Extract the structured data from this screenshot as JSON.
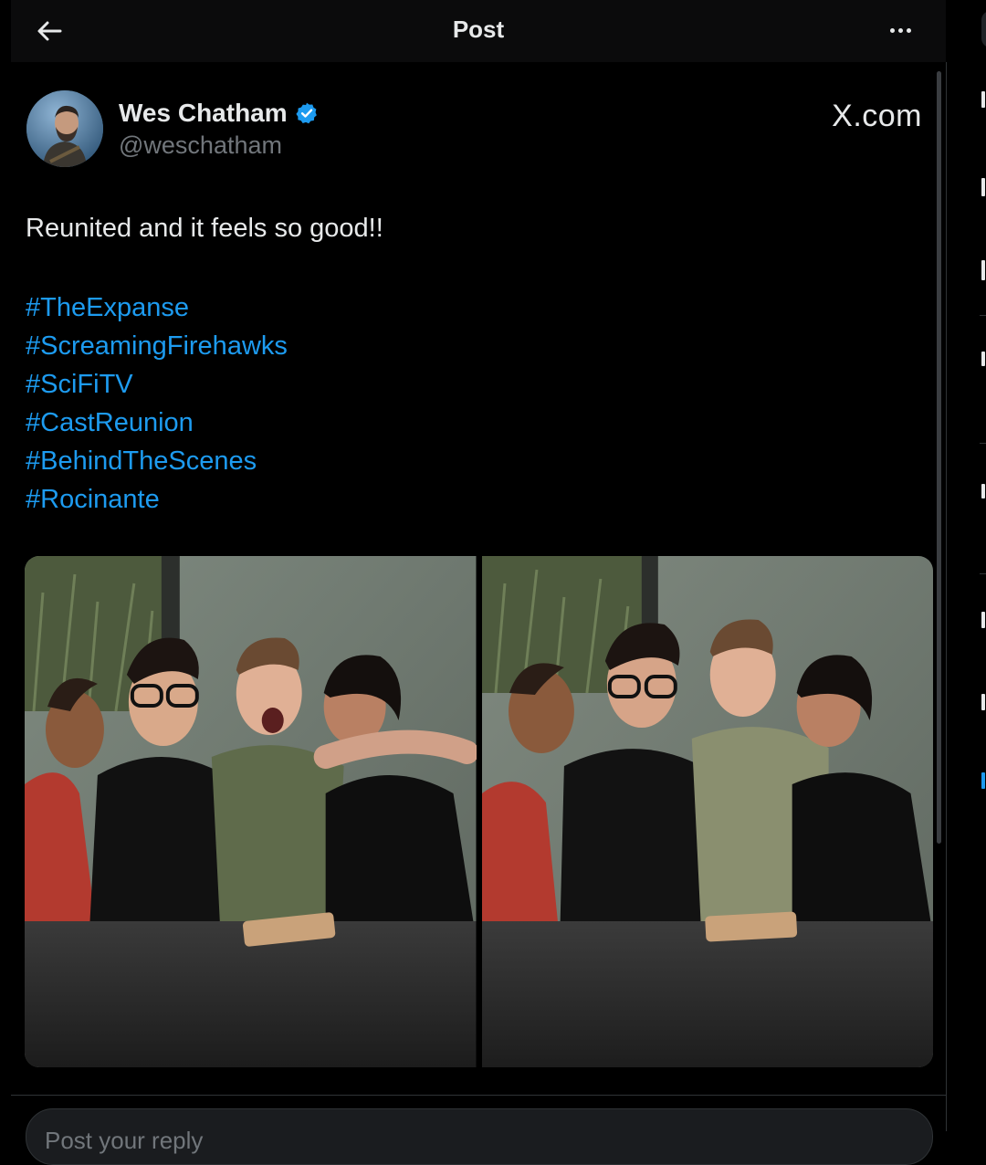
{
  "header": {
    "title": "Post"
  },
  "post": {
    "author_name": "Wes Chatham",
    "author_handle": "@weschatham",
    "watermark": "X.com",
    "text": "Reunited and it feels so good!!",
    "hashtags": [
      "#TheExpanse",
      "#ScreamingFirehawks",
      "#SciFiTV",
      "#CastReunion",
      "#BehindTheScenes",
      "#Rocinante"
    ],
    "verified": true
  },
  "reply": {
    "placeholder": "Post your reply"
  },
  "colors": {
    "background": "#000000",
    "text": "#e7e9ea",
    "secondary_text": "#71767b",
    "link": "#1d9bf0",
    "verified_badge": "#1d9bf0"
  },
  "icons": {
    "back": "arrow-left-icon",
    "more": "more-horizontal-icon",
    "verified": "verified-badge-icon"
  }
}
